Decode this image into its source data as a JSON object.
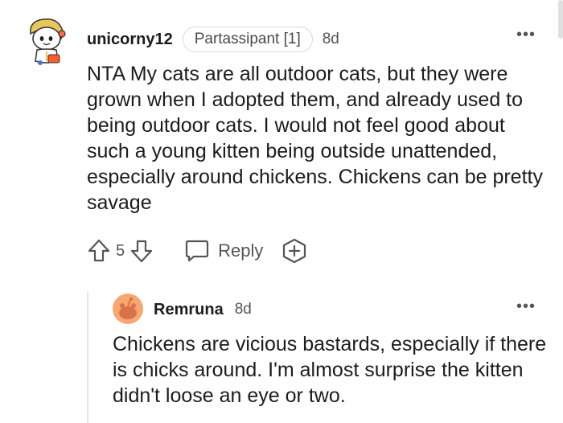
{
  "comment": {
    "username": "unicorny12",
    "flair": "Partassipant [1]",
    "age": "8d",
    "more_label": "•••",
    "avatar_icon": "snoo-avatar-icon",
    "body": "NTA My cats are all outdoor cats, but they were grown when I adopted them, and already used to being outdoor cats. I would not feel good about such a young kitten being outside unattended, especially around chickens. Chickens can be pretty savage",
    "score": "5",
    "reply_label": "Reply"
  },
  "reply": {
    "username": "Remruna",
    "age": "8d",
    "more_label": "•••",
    "avatar_icon": "default-snoo-avatar-icon",
    "body": "Chickens are vicious bastards, especially if there is chicks around. I'm almost surprise the kitten didn't loose an eye or two."
  },
  "colors": {
    "text": "#1c1c1c",
    "muted": "#555555",
    "reply_avatar_bg": "#f6a870"
  }
}
